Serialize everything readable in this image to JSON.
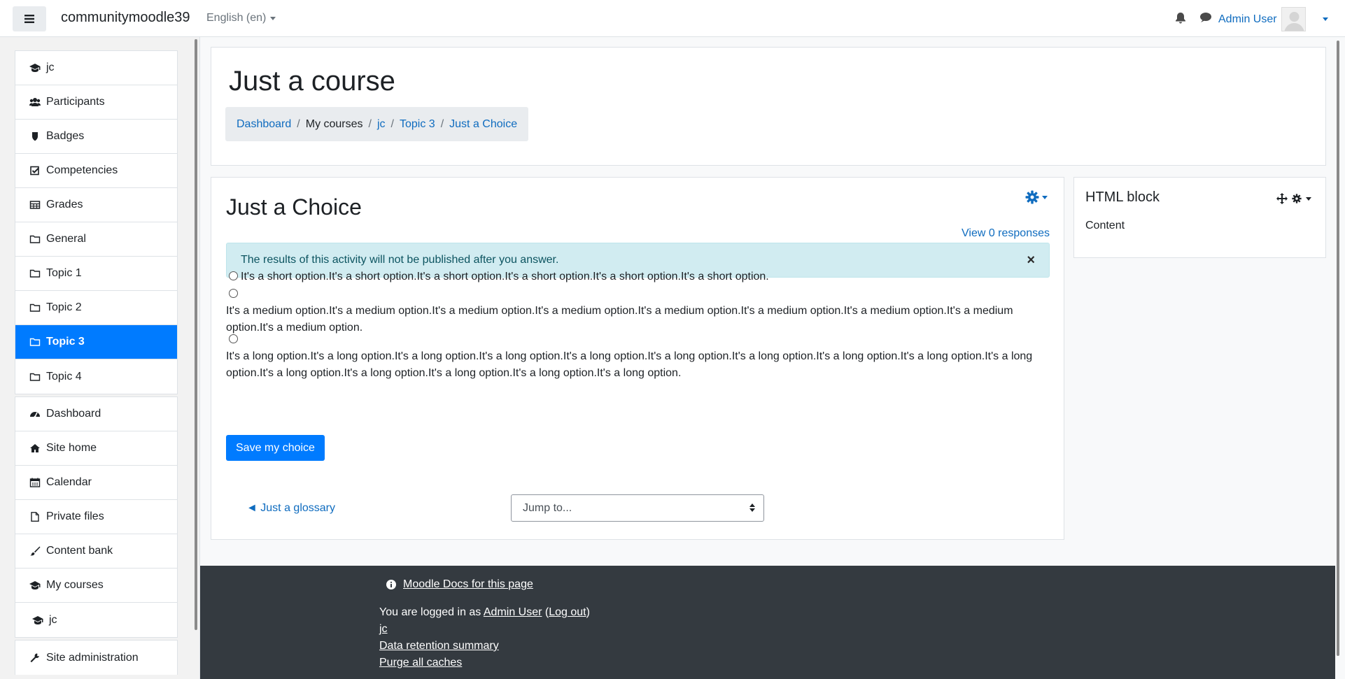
{
  "navbar": {
    "site_name": "communitymoodle39",
    "language": "English (en)",
    "user_name": "Admin User"
  },
  "drawer": {
    "course_items": [
      {
        "label": "jc",
        "icon": "graduation-cap-icon"
      },
      {
        "label": "Participants",
        "icon": "users-icon"
      },
      {
        "label": "Badges",
        "icon": "shield-icon"
      },
      {
        "label": "Competencies",
        "icon": "check-square-icon"
      },
      {
        "label": "Grades",
        "icon": "table-icon"
      },
      {
        "label": "General",
        "icon": "folder-icon"
      },
      {
        "label": "Topic 1",
        "icon": "folder-icon"
      },
      {
        "label": "Topic 2",
        "icon": "folder-icon"
      },
      {
        "label": "Topic 3",
        "icon": "folder-icon",
        "active": true
      },
      {
        "label": "Topic 4",
        "icon": "folder-icon"
      }
    ],
    "site_items": [
      {
        "label": "Dashboard",
        "icon": "tachometer-icon"
      },
      {
        "label": "Site home",
        "icon": "home-icon"
      },
      {
        "label": "Calendar",
        "icon": "calendar-icon"
      },
      {
        "label": "Private files",
        "icon": "file-icon"
      },
      {
        "label": "Content bank",
        "icon": "paint-brush-icon"
      },
      {
        "label": "My courses",
        "icon": "graduation-cap-icon"
      },
      {
        "label": "jc",
        "icon": "graduation-cap-icon"
      }
    ],
    "admin_items": [
      {
        "label": "Site administration",
        "icon": "wrench-icon"
      }
    ]
  },
  "header": {
    "course_title": "Just a course",
    "breadcrumb": [
      "Dashboard",
      "My courses",
      "jc",
      "Topic 3",
      "Just a Choice"
    ]
  },
  "activity": {
    "title": "Just a Choice",
    "view_responses": "View 0 responses",
    "alert": "The results of this activity will not be published after you answer.",
    "alert_close": "×",
    "options": [
      "It's a short option.It's a short option.It's a short option.It's a short option.It's a short option.It's a short option.",
      "It's a medium option.It's a medium option.It's a medium option.It's a medium option.It's a medium option.It's a medium option.It's a medium option.It's a medium option.It's a medium option.",
      "It's a long option.It's a long option.It's a long option.It's a long option.It's a long option.It's a long option.It's a long option.It's a long option.It's a long option.It's a long option.It's a long option.It's a long option.It's a long option.It's a long option.It's a long option."
    ],
    "save_label": "Save my choice",
    "prev_activity": "◄ Just a glossary",
    "jump_placeholder": "Jump to..."
  },
  "html_block": {
    "title": "HTML block",
    "content": "Content"
  },
  "footer": {
    "docs_link": "Moodle Docs for this page",
    "logged_in_prefix": "You are logged in as ",
    "logged_in_user": "Admin User",
    "logout": "Log out",
    "links": [
      "jc",
      "Data retention summary",
      "Purge all caches"
    ]
  },
  "colors": {
    "primary": "#007bff",
    "link": "#0f6cbf",
    "alert_bg": "#d1ecf1",
    "footer_bg": "#343a40"
  }
}
